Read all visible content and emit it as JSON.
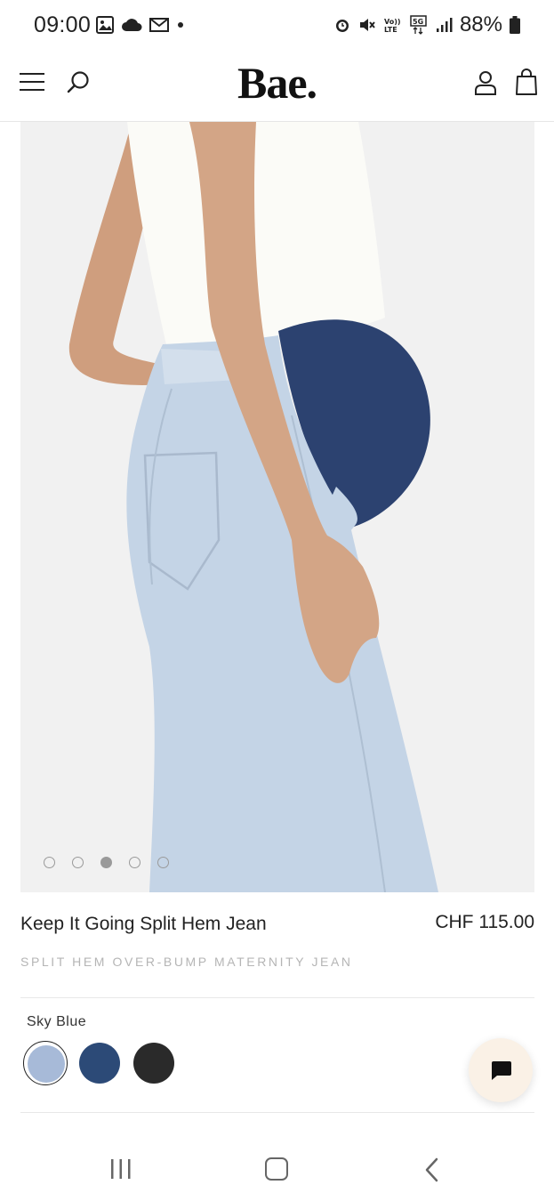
{
  "status_bar": {
    "time": "09:00",
    "battery": "88%",
    "icons": [
      "gallery-icon",
      "cloud-icon",
      "mail-icon",
      "dot-icon",
      "alarm-icon",
      "mute-icon",
      "volte-icon",
      "5g-icon",
      "signal-icon",
      "battery-icon"
    ]
  },
  "header": {
    "logo": "Bae.",
    "icons": [
      "menu-icon",
      "search-icon",
      "account-icon",
      "bag-icon"
    ]
  },
  "carousel": {
    "slide_count": 5,
    "active_index": 2
  },
  "product": {
    "name": "Keep It Going Split Hem Jean",
    "price": "CHF 115.00",
    "subtitle": "SPLIT HEM OVER-BUMP MATERNITY JEAN",
    "selected_color": "Sky Blue",
    "swatches": [
      {
        "name": "Sky Blue",
        "color": "#a7bad8",
        "selected": true
      },
      {
        "name": "Navy",
        "color": "#2c4a77",
        "selected": false
      },
      {
        "name": "Black",
        "color": "#2a2a2a",
        "selected": false
      }
    ]
  },
  "chat": {
    "icon": "chat-icon",
    "background": "#faf1e6"
  },
  "colors": {
    "background": "#ffffff",
    "text": "#222222",
    "muted": "#b5b5b5"
  }
}
